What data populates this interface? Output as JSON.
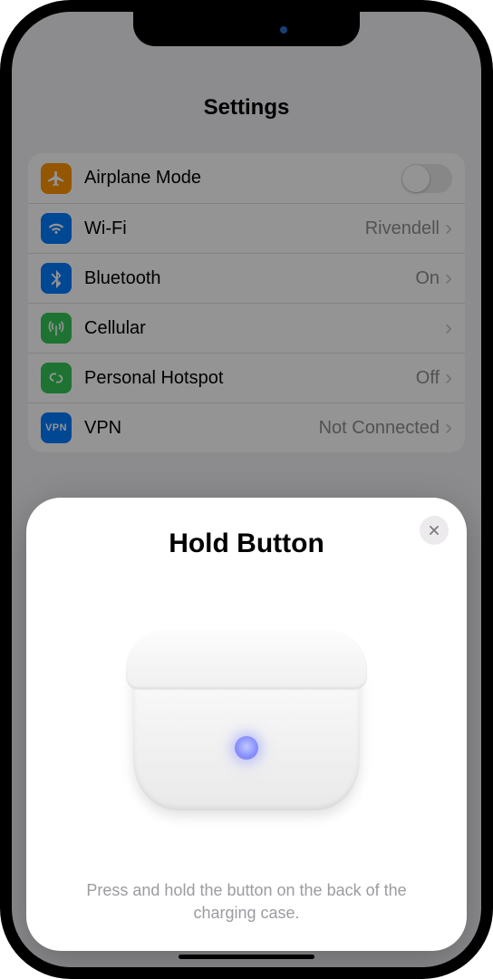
{
  "header": {
    "title": "Settings"
  },
  "rows": {
    "airplane": {
      "label": "Airplane Mode"
    },
    "wifi": {
      "label": "Wi-Fi",
      "value": "Rivendell"
    },
    "bluetooth": {
      "label": "Bluetooth",
      "value": "On"
    },
    "cellular": {
      "label": "Cellular"
    },
    "hotspot": {
      "label": "Personal Hotspot",
      "value": "Off"
    },
    "vpn": {
      "label": "VPN",
      "value": "Not Connected",
      "icon_text": "VPN"
    }
  },
  "sheet": {
    "title": "Hold Button",
    "instruction": "Press and hold the button on the back of the charging case."
  }
}
